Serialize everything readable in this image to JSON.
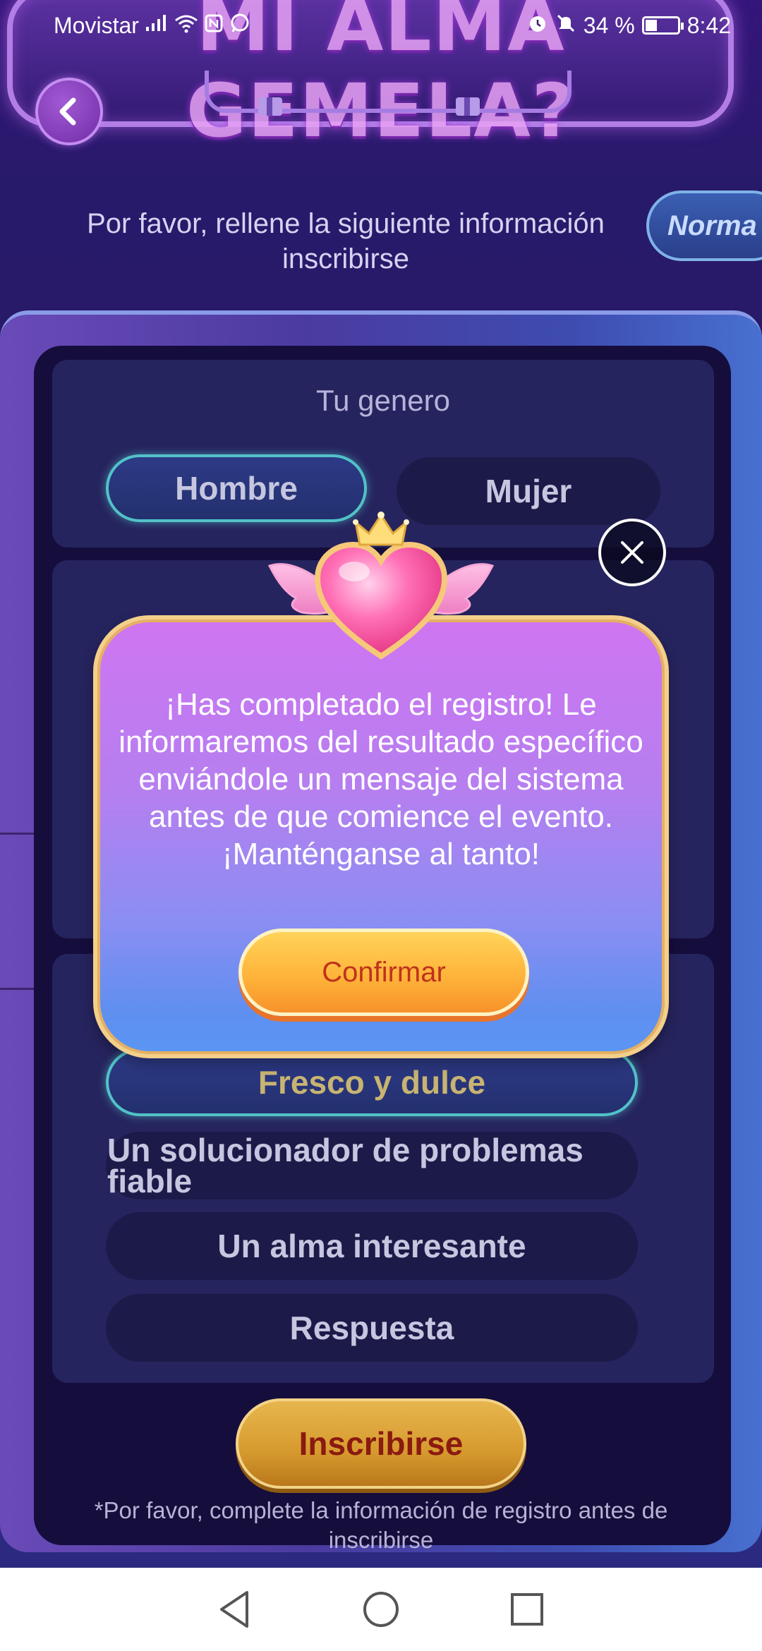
{
  "status_bar": {
    "carrier": "Movistar",
    "battery_percent": "34 %",
    "time": "8:42",
    "icons": [
      "signal-icon",
      "wifi-icon",
      "nfc-icon",
      "whatsapp-icon",
      "alarm-icon",
      "mute-icon",
      "battery-icon"
    ]
  },
  "header": {
    "title": "MI ALMA GEMELA?"
  },
  "instruction": {
    "text": "Por favor, rellene la siguiente información para inscribirse",
    "line1": "Por favor, rellene la siguiente información",
    "line2": "inscribirse"
  },
  "mode_pill": {
    "label": "Norma"
  },
  "gender": {
    "title": "Tu genero",
    "options": [
      "Hombre",
      "Mujer"
    ],
    "selected": "Hombre"
  },
  "question_options": {
    "items": [
      {
        "label": "Fresco y dulce",
        "selected": true
      },
      {
        "label": "Un solucionador de problemas fiable",
        "selected": false
      },
      {
        "label": "Un alma interesante",
        "selected": false
      },
      {
        "label": "Respuesta",
        "selected": false
      }
    ]
  },
  "register_button": {
    "label": "Inscribirse"
  },
  "footnote": "*Por favor, complete la información de registro antes de inscribirse",
  "dialog": {
    "message": "¡Has completado el registro! Le informaremos del resultado específico enviándole un mensaje del sistema antes de que comience el evento. ¡Manténganse al tanto!",
    "confirm_label": "Confirmar",
    "close_icon": "close-icon",
    "badge_icon": "winged-heart-crown-icon"
  },
  "colors": {
    "background": "#271a66",
    "dialog_top": "#cf75f2",
    "dialog_bottom": "#5a96f4",
    "confirm_button": "#ffb43a",
    "selected_border": "#52c2c8"
  },
  "nav_bar": {
    "icons": [
      "back-triangle-icon",
      "home-circle-icon",
      "recents-square-icon"
    ]
  }
}
